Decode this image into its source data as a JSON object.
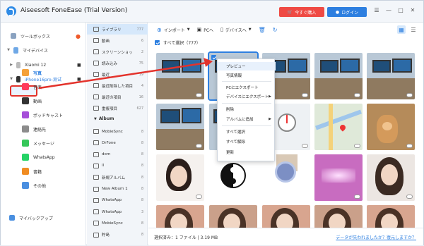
{
  "window": {
    "title": "Aiseesoft FoneEase (Trial Version)"
  },
  "titlebar": {
    "buy_label": "今すぐ購入",
    "login_label": "ログイン"
  },
  "sidebar": {
    "toolbox": "ツールボックス",
    "my_device": "マイデバイス",
    "devices": [
      {
        "name": "Xiaomi 12"
      },
      {
        "name": "iPhone16pro-测试"
      }
    ],
    "items": [
      {
        "label": "写真",
        "icon": "photos-icon",
        "color": "#f4a13a"
      },
      {
        "label": "音楽",
        "icon": "music-icon",
        "color": "#ff3b5c"
      },
      {
        "label": "動画",
        "icon": "video-icon",
        "color": "#333333"
      },
      {
        "label": "ポッドキャスト",
        "icon": "podcast-icon",
        "color": "#a64fd9"
      },
      {
        "label": "連絡先",
        "icon": "contacts-icon",
        "color": "#8c8c8c"
      },
      {
        "label": "メッセージ",
        "icon": "messages-icon",
        "color": "#35c759"
      },
      {
        "label": "WhatsApp",
        "icon": "whatsapp-icon",
        "color": "#25d366"
      },
      {
        "label": "書籍",
        "icon": "books-icon",
        "color": "#f08c22"
      },
      {
        "label": "その他",
        "icon": "other-icon",
        "color": "#4a8fe0"
      }
    ],
    "backup": "マイバックアップ"
  },
  "categories": [
    {
      "label": "ライブラリ",
      "count": "777"
    },
    {
      "label": "動画",
      "count": "6"
    },
    {
      "label": "スクリーンショット",
      "count": "2"
    },
    {
      "label": "読み込み",
      "count": "75"
    },
    {
      "label": "最近",
      "count": "19"
    },
    {
      "label": "最近削除した項目",
      "count": "4"
    },
    {
      "label": "最近の項目",
      "count": "16"
    },
    {
      "label": "重複項目",
      "count": "627"
    }
  ],
  "album_heading": "Album",
  "albums": [
    {
      "label": "MobieSync",
      "count": "8"
    },
    {
      "label": "DrFone",
      "count": "8"
    },
    {
      "label": "dom",
      "count": "8"
    },
    {
      "label": "ll",
      "count": "8"
    },
    {
      "label": "新規アルバム",
      "count": "8"
    },
    {
      "label": "New Album 1",
      "count": "8"
    },
    {
      "label": "WhatsApp",
      "count": "8"
    },
    {
      "label": "WhatsApp",
      "count": "3"
    },
    {
      "label": "MobieSync",
      "count": "8"
    },
    {
      "label": "貯島",
      "count": "8"
    }
  ],
  "toolbar": {
    "import": "インポート",
    "to_pc": "PCへ",
    "to_device": "デバイスへ"
  },
  "select_all": "すべて選択（777）",
  "context_menu": [
    "プレビュー",
    "写真情報",
    "PCにエクスポート",
    "デバイスにエクスポート",
    "削除",
    "アルバムに追加",
    "すべて選択",
    "すべて解除",
    "更新"
  ],
  "status": {
    "selection": "選択済み：1 ファイル | 3.19 MB",
    "link": "データが失われましたか？復元しますか？"
  },
  "colors": {
    "accent": "#2d7fe0",
    "buy": "#ef4a44",
    "highlight": "#e3322b"
  }
}
